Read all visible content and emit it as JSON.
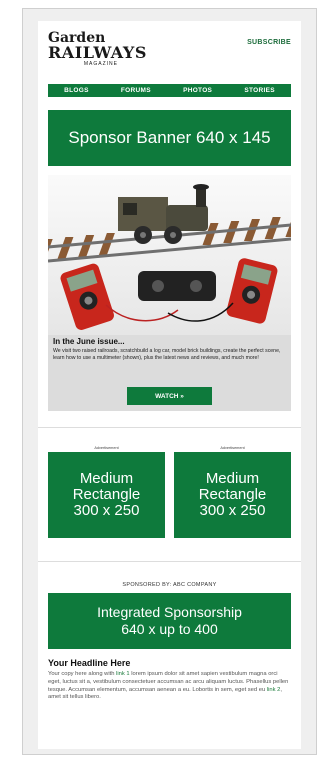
{
  "header": {
    "logo_line1": "Garden",
    "logo_line2": "RAILWAYS",
    "logo_line3": "MAGAZINE",
    "subscribe": "SUBSCRIBE"
  },
  "nav": [
    {
      "label": "BLOGS"
    },
    {
      "label": "FORUMS"
    },
    {
      "label": "PHOTOS"
    },
    {
      "label": "STORIES"
    }
  ],
  "sponsor_banner": "Sponsor Banner 640 x 145",
  "feature": {
    "title": "In the June issue...",
    "body": "We visit two raised railroads, scratchbuild a log car, model brick buildings, create the perfect scene, learn how to use a multimeter (shown), plus the latest news and reviews, and much more!",
    "button": "WATCH »"
  },
  "ads": {
    "label": "Advertisement",
    "rect_line1": "Medium",
    "rect_line2": "Rectangle",
    "rect_line3": "300 x 250"
  },
  "sponsored_by": "SPONSORED BY: ABC COMPANY",
  "integrated": {
    "line1": "Integrated Sponsorship",
    "line2": "640 x up to 400"
  },
  "article": {
    "headline": "Your Headline Here",
    "copy_a": "Your copy here along with ",
    "link1": "link 1",
    "copy_b": " lorem ipsum dolor sit amet sapien vestibulum magna orci eget, luctus sit a, vestibulum consectetuer accumsan ac arcu aliquam luctus. Phasellus pellen tesque. Accumsan elementum, accumsan aenean a eu. Lobortis in sem, eget sed eu ",
    "link2": "link 2",
    "copy_c": ", amet sit tellus libero."
  },
  "colors": {
    "brand_green": "#0e7a3c",
    "feature_bg": "#dcdcdc",
    "frame_bg": "#efefef"
  }
}
